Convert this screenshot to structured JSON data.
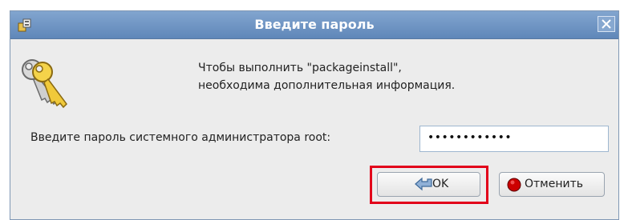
{
  "window": {
    "title": "Введите пароль"
  },
  "message": {
    "line1": "Чтобы выполнить \"packageinstall\",",
    "line2": "необходима дополнительная информация."
  },
  "prompt": {
    "label": "Введите пароль системного администратора root:"
  },
  "password_field": {
    "value": "••••••••••••"
  },
  "buttons": {
    "ok": "OK",
    "cancel": "Отменить"
  },
  "icons": {
    "app": "app-icon",
    "close": "close-icon",
    "keys": "keys-icon",
    "ok": "arrow-left-icon",
    "cancel": "stop-icon"
  },
  "colors": {
    "titlebar": "#6f95c5",
    "highlight": "#e2001a",
    "cancel_icon": "#cc0000"
  }
}
